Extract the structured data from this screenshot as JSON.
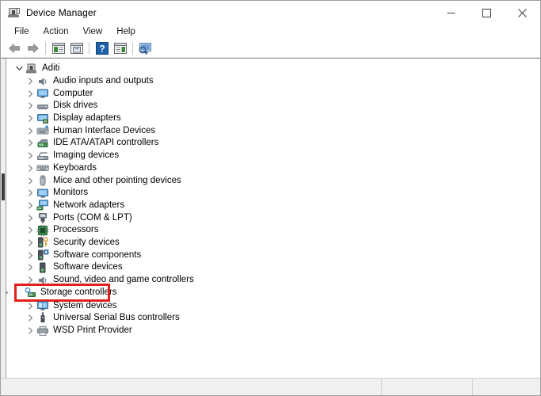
{
  "window": {
    "title": "Device Manager",
    "title_icon": "device-manager-icon",
    "controls": {
      "minimize": "minimize-icon",
      "maximize": "maximize-icon",
      "close": "close-icon"
    }
  },
  "menu": {
    "items": [
      {
        "label": "File"
      },
      {
        "label": "Action"
      },
      {
        "label": "View"
      },
      {
        "label": "Help"
      }
    ]
  },
  "toolbar": {
    "buttons": [
      {
        "name": "back-arrow-icon",
        "type": "back"
      },
      {
        "name": "forward-arrow-icon",
        "type": "forward"
      },
      {
        "name": "separator",
        "type": "sep"
      },
      {
        "name": "properties-icon",
        "type": "props"
      },
      {
        "name": "update-driver-icon",
        "type": "save"
      },
      {
        "name": "separator",
        "type": "sep"
      },
      {
        "name": "help-icon",
        "type": "help"
      },
      {
        "name": "show-hidden-devices-icon",
        "type": "props2"
      },
      {
        "name": "separator",
        "type": "sep"
      },
      {
        "name": "scan-hardware-changes-icon",
        "type": "scan"
      }
    ]
  },
  "tree": {
    "root": {
      "label": "Aditi",
      "icon": "computer-root-icon",
      "expanded": true,
      "twisty": "chevron-down-icon"
    },
    "items": [
      {
        "label": "Audio inputs and outputs",
        "icon": "speaker-icon",
        "twisty": "chevron-right-icon",
        "highlighted": false
      },
      {
        "label": "Computer",
        "icon": "monitor-icon",
        "twisty": "chevron-right-icon",
        "highlighted": false
      },
      {
        "label": "Disk drives",
        "icon": "disk-drive-icon",
        "twisty": "chevron-right-icon",
        "highlighted": false
      },
      {
        "label": "Display adapters",
        "icon": "display-adapter-icon",
        "twisty": "chevron-right-icon",
        "highlighted": false
      },
      {
        "label": "Human Interface Devices",
        "icon": "hid-icon",
        "twisty": "chevron-right-icon",
        "highlighted": false
      },
      {
        "label": "IDE ATA/ATAPI controllers",
        "icon": "ide-controller-icon",
        "twisty": "chevron-right-icon",
        "highlighted": false
      },
      {
        "label": "Imaging devices",
        "icon": "imaging-device-icon",
        "twisty": "chevron-right-icon",
        "highlighted": false
      },
      {
        "label": "Keyboards",
        "icon": "keyboard-icon",
        "twisty": "chevron-right-icon",
        "highlighted": false
      },
      {
        "label": "Mice and other pointing devices",
        "icon": "mouse-icon",
        "twisty": "chevron-right-icon",
        "highlighted": false
      },
      {
        "label": "Monitors",
        "icon": "monitor-icon",
        "twisty": "chevron-right-icon",
        "highlighted": false
      },
      {
        "label": "Network adapters",
        "icon": "network-adapter-icon",
        "twisty": "chevron-right-icon",
        "highlighted": false
      },
      {
        "label": "Ports (COM & LPT)",
        "icon": "port-icon",
        "twisty": "chevron-right-icon",
        "highlighted": false
      },
      {
        "label": "Processors",
        "icon": "processor-icon",
        "twisty": "chevron-right-icon",
        "highlighted": false
      },
      {
        "label": "Security devices",
        "icon": "security-device-icon",
        "twisty": "chevron-right-icon",
        "highlighted": false
      },
      {
        "label": "Software components",
        "icon": "software-component-icon",
        "twisty": "chevron-right-icon",
        "highlighted": false
      },
      {
        "label": "Software devices",
        "icon": "software-device-icon",
        "twisty": "chevron-right-icon",
        "highlighted": false
      },
      {
        "label": "Sound, video and game controllers",
        "icon": "sound-controller-icon",
        "twisty": "chevron-right-icon",
        "highlighted": false
      },
      {
        "label": "Storage controllers",
        "icon": "storage-controller-icon",
        "twisty": "chevron-right-icon",
        "highlighted": true
      },
      {
        "label": "System devices",
        "icon": "system-device-icon",
        "twisty": "chevron-right-icon",
        "highlighted": false
      },
      {
        "label": "Universal Serial Bus controllers",
        "icon": "usb-controller-icon",
        "twisty": "chevron-right-icon",
        "highlighted": false
      },
      {
        "label": "WSD Print Provider",
        "icon": "printer-icon",
        "twisty": "chevron-right-icon",
        "highlighted": false
      }
    ]
  },
  "statusbar": {
    "main": "",
    "secondary": "",
    "tertiary": ""
  },
  "colors": {
    "highlight_red": "#e2211c",
    "titlebar_bg": "#ffffff",
    "statusbar_bg": "#f0f0f0",
    "text": "#000000"
  }
}
